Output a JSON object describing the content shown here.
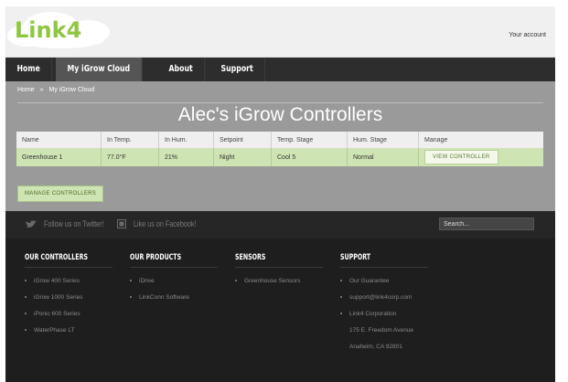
{
  "header": {
    "logo_text": "Link4",
    "account_link": "Your account"
  },
  "nav": {
    "items": [
      {
        "label": "Home",
        "active": false
      },
      {
        "label": "My iGrow Cloud",
        "active": true
      },
      {
        "label": "About",
        "active": false
      },
      {
        "label": "Support",
        "active": false
      }
    ]
  },
  "breadcrumb": {
    "home": "Home",
    "separator": "»",
    "current": "My iGrow Cloud"
  },
  "page_title": "Alec's iGrow Controllers",
  "table": {
    "headers": [
      "Name",
      "In Temp.",
      "In Hum.",
      "Setpoint",
      "Temp. Stage",
      "Hum. Stage",
      "Manage"
    ],
    "rows": [
      {
        "name": "Greenhouse 1",
        "in_temp": "77.0°F",
        "in_hum": "21%",
        "setpoint": "Night",
        "temp_stage": "Cool 5",
        "hum_stage": "Normal",
        "action": "VIEW CONTROLLER"
      }
    ]
  },
  "manage_button": "MANAGE CONTROLLERS",
  "social": {
    "twitter": "Follow us on Twitter!",
    "facebook": "Like us on Facebook!",
    "search_placeholder": "Search..."
  },
  "footer": {
    "controllers": {
      "title": "OUR CONTROLLERS",
      "items": [
        "iGrow 400 Series",
        "iGrow 1000 Series",
        "iPonic 600 Series",
        "WaterPhase LT"
      ]
    },
    "products": {
      "title": "OUR PRODUCTS",
      "items": [
        "iDrive",
        "LinkConn Software"
      ]
    },
    "sensors": {
      "title": "SENSORS",
      "items": [
        "Greenhouse Sensors"
      ]
    },
    "support": {
      "title": "SUPPORT",
      "items": [
        "Our Guarantee",
        "support@link4corp.com",
        "Link4 Corporation"
      ],
      "address_lines": [
        "175 E. Freedom Avenue",
        "Anaheim, CA 92801"
      ]
    }
  },
  "colors": {
    "brand_green": "#8fc640",
    "nav_bg": "#2d2d2d",
    "content_bg": "#9a9a9a",
    "row_green": "#cfe4b3",
    "footer_bg": "#1e1e1e"
  }
}
